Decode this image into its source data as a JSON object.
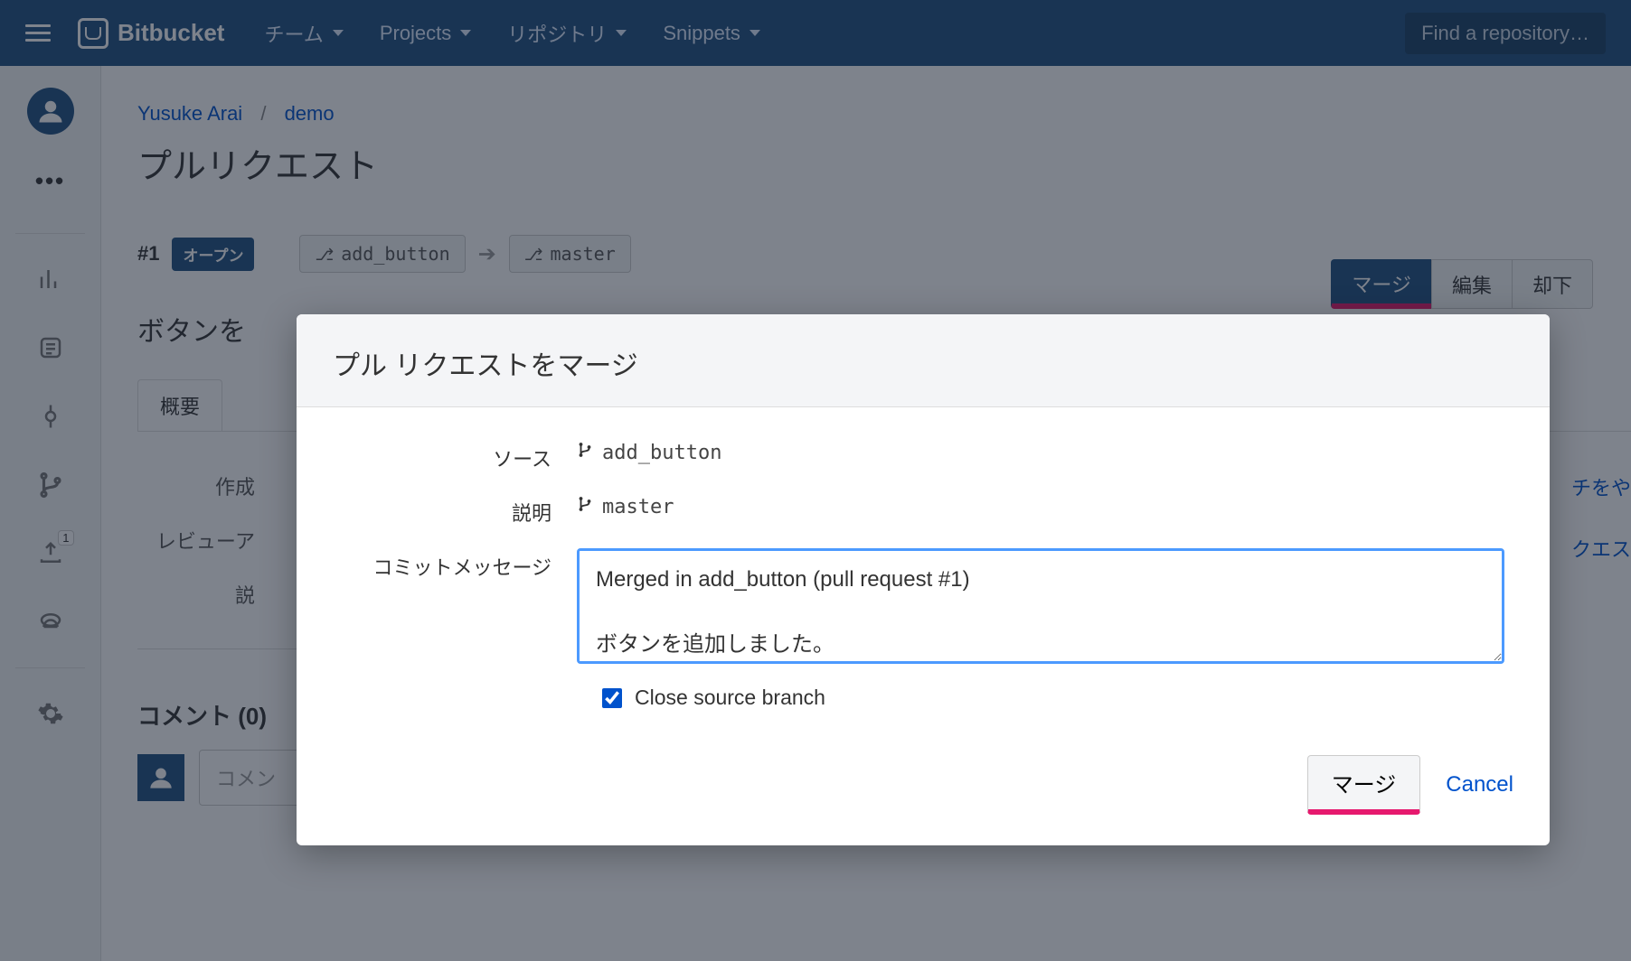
{
  "topnav": {
    "product": "Bitbucket",
    "items": [
      "チーム",
      "Projects",
      "リポジトリ",
      "Snippets"
    ],
    "search_placeholder": "Find a repository…"
  },
  "breadcrumb": {
    "owner": "Yusuke Arai",
    "repo": "demo"
  },
  "page_title": "プルリクエスト",
  "pr": {
    "number": "#1",
    "state_label": "オープン",
    "source_branch": "add_button",
    "target_branch": "master",
    "subtitle_prefix": "ボタンを",
    "tab_overview": "概要",
    "meta_created": "作成",
    "meta_reviewer": "レビューア",
    "meta_desc": "説",
    "sidelink1": "チをや",
    "sidelink2": "クエス"
  },
  "actions": {
    "merge": "マージ",
    "edit": "編集",
    "decline": "却下"
  },
  "comments": {
    "header": "コメント (0)",
    "placeholder": "コメン"
  },
  "leftrail": {
    "upload_badge": "1"
  },
  "dialog": {
    "title": "プル リクエストをマージ",
    "source_label": "ソース",
    "target_label": "説明",
    "source_branch": "add_button",
    "target_branch": "master",
    "commit_label": "コミットメッセージ",
    "commit_message": "Merged in add_button (pull request #1)\n\nボタンを追加しました。",
    "close_branch_label": "Close source branch",
    "merge_btn": "マージ",
    "cancel_btn": "Cancel"
  }
}
